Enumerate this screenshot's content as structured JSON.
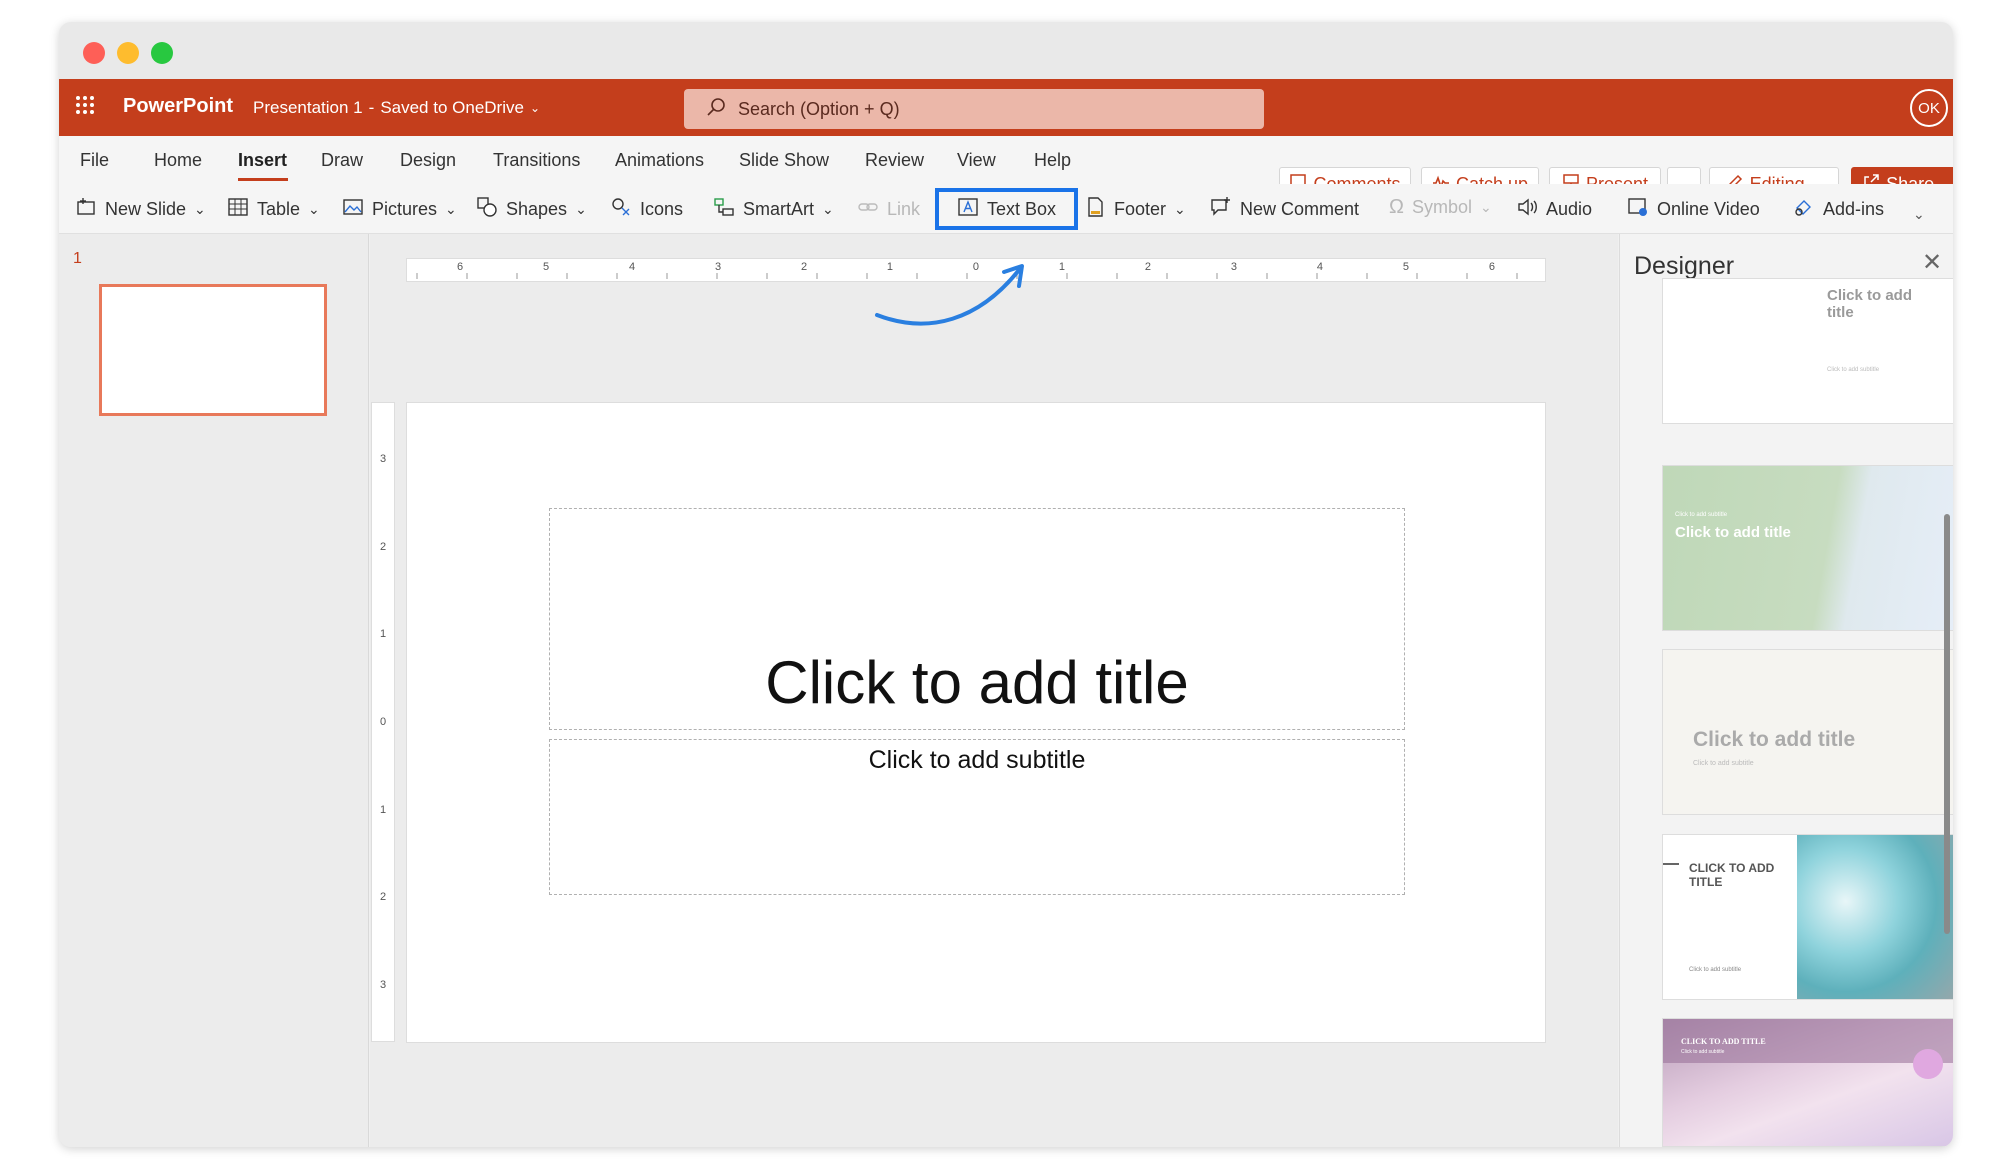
{
  "app": {
    "name": "PowerPoint",
    "document_title": "Presentation 1",
    "separator": "-",
    "save_status": "Saved to OneDrive",
    "user_initials": "OK"
  },
  "search": {
    "placeholder": "Search (Option + Q)"
  },
  "tabs": [
    "File",
    "Home",
    "Insert",
    "Draw",
    "Design",
    "Transitions",
    "Animations",
    "Slide Show",
    "Review",
    "View",
    "Help"
  ],
  "active_tab": "Insert",
  "actions": {
    "comments": "Comments",
    "catch_up": "Catch up",
    "present": "Present",
    "editing": "Editing",
    "share": "Share"
  },
  "ribbon": {
    "new_slide": "New Slide",
    "table": "Table",
    "pictures": "Pictures",
    "shapes": "Shapes",
    "icons": "Icons",
    "smartart": "SmartArt",
    "link": "Link",
    "text_box": "Text Box",
    "footer": "Footer",
    "new_comment": "New Comment",
    "symbol": "Symbol",
    "audio": "Audio",
    "online_video": "Online Video",
    "add_ins": "Add-ins"
  },
  "slides_pane": {
    "slide_number": "1"
  },
  "slide": {
    "title_placeholder": "Click to add title",
    "subtitle_placeholder": "Click to add subtitle"
  },
  "designer": {
    "title": "Designer",
    "designs": [
      {
        "title": "Click to add title",
        "subtitle": "Click to add subtitle"
      },
      {
        "title": "Click to add title",
        "subtitle": "Click to add subtitle"
      },
      {
        "title": "Click to add title",
        "subtitle": "Click to add subtitle"
      },
      {
        "title": "CLICK TO ADD TITLE",
        "subtitle": "Click to add subtitle"
      },
      {
        "title": "CLICK TO ADD TITLE",
        "subtitle": "Click to add subtitle"
      }
    ]
  },
  "ruler": {
    "h_labels": [
      "6",
      "5",
      "4",
      "3",
      "2",
      "1",
      "0",
      "1",
      "2",
      "3",
      "4",
      "5",
      "6"
    ],
    "v_labels": [
      "3",
      "2",
      "1",
      "0",
      "1",
      "2",
      "3"
    ]
  },
  "colors": {
    "brand": "#c43e1c",
    "highlight": "#1a73e8",
    "selected_slide_border": "#e8795a"
  }
}
